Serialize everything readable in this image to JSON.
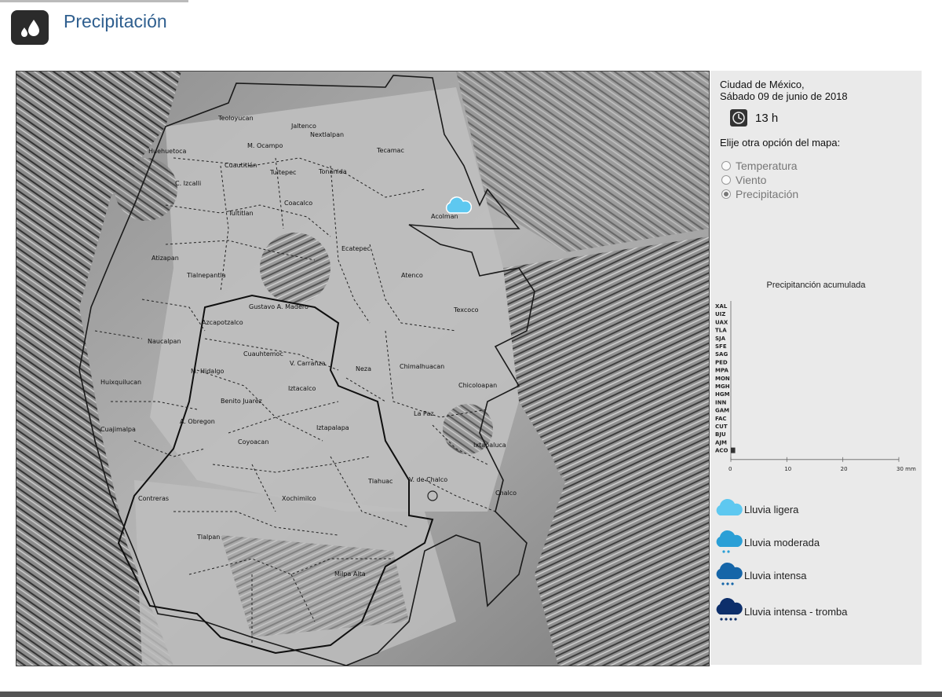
{
  "header": {
    "title": "Precipitación",
    "icon": "raindrops-icon"
  },
  "panel": {
    "location_line1": "Ciudad de México,",
    "location_line2": "Sábado 09 de junio de 2018",
    "hour": "13 h",
    "options_title": "Elije otra opción del mapa:",
    "options": [
      {
        "label": "Temperatura",
        "selected": false
      },
      {
        "label": "Viento",
        "selected": false
      },
      {
        "label": "Precipitación",
        "selected": true
      }
    ],
    "chart_title": "Precipitanción acumulada",
    "legend": [
      {
        "label": "Lluvia ligera",
        "color": "#5ec8f0"
      },
      {
        "label": "Lluvia moderada",
        "color": "#2a9fd6"
      },
      {
        "label": "Lluvia intensa",
        "color": "#1565a8"
      },
      {
        "label": "Lluvia intensa - tromba",
        "color": "#0d2f6b"
      }
    ]
  },
  "map": {
    "labels": [
      "Teoloyucan",
      "Jaltenco",
      "Nextlalpan",
      "Tecamac",
      "M. Ocampo",
      "Cuautitlán",
      "Tultepec",
      "Tonanida",
      "C. Izcalli",
      "Coacalco",
      "Tultitlan",
      "Acolman",
      "Ecatepec",
      "Atizapan",
      "Tlalnepantla",
      "Atenco",
      "Gustavo A. Madero",
      "Azcapotzalco",
      "Texcoco",
      "Cuauhtemoc",
      "V. Carranza",
      "M. Hidalgo",
      "Neza",
      "Chimalhuacan",
      "Iztacalco",
      "Chicoloapan",
      "Benito Juarez",
      "A. Obregon",
      "La Paz",
      "Iztapalapa",
      "Coyoacan",
      "Ixtapaluca",
      "Tlahuac",
      "V. de Chalco",
      "Chalco",
      "Xochimilco",
      "Contreras",
      "Tlalpan",
      "Milpa Alta",
      "Huixquilucan",
      "Naucalpan",
      "Cuajimalpa",
      "Cuautitlan"
    ],
    "marker": {
      "station": "Acolman",
      "condition": "Lluvia ligera"
    }
  },
  "chart_data": {
    "type": "bar",
    "title": "Precipitanción acumulada",
    "categories": [
      "XAL",
      "UIZ",
      "UAX",
      "TLA",
      "SJA",
      "SFE",
      "SAG",
      "PED",
      "MPA",
      "MON",
      "MGH",
      "HGM",
      "INN",
      "GAM",
      "FAC",
      "CUT",
      "BJU",
      "AJM",
      "ACO"
    ],
    "values": [
      0,
      0,
      0,
      0,
      0,
      0,
      0,
      0,
      0,
      0,
      0,
      0,
      0,
      0,
      0,
      0,
      0,
      0,
      0.5
    ],
    "xticks": [
      0,
      10,
      20,
      30
    ],
    "xlim": [
      0,
      30
    ],
    "xunit": "mm"
  }
}
